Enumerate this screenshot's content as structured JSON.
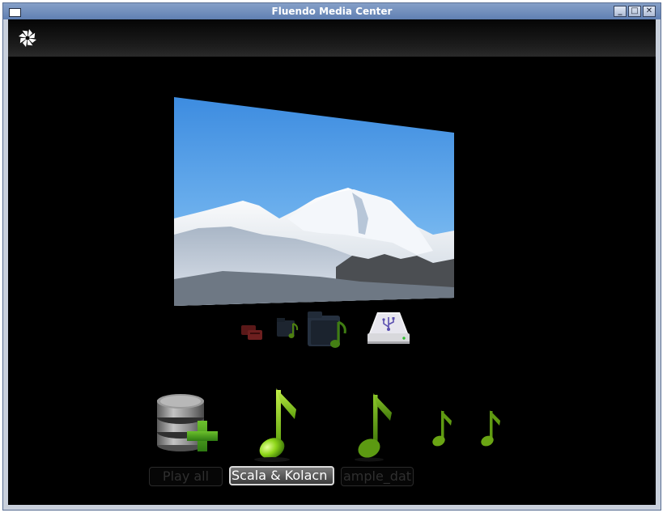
{
  "window": {
    "title": "Fluendo Media Center",
    "buttons": [
      "minimize",
      "maximize",
      "close"
    ]
  },
  "topbar": {
    "logo_icon": "fluendo-pinwheel-icon"
  },
  "preview": {
    "image": "snowy-mountain-photo"
  },
  "devices": [
    {
      "icon": "media-cards-icon",
      "selected": false
    },
    {
      "icon": "music-folder-icon",
      "selected": false
    },
    {
      "icon": "music-folder-icon",
      "selected": false
    },
    {
      "icon": "usb-drive-icon",
      "selected": true
    }
  ],
  "items": [
    {
      "icon": "database-add-icon",
      "label": "Play all",
      "selected": false
    },
    {
      "icon": "music-note-icon",
      "label": "Scala & Kolacn",
      "selected": true
    },
    {
      "icon": "music-note-icon",
      "label": "ample_dat",
      "selected": false
    },
    {
      "icon": "music-note-icon",
      "label": "",
      "selected": false
    },
    {
      "icon": "music-note-icon",
      "label": "",
      "selected": false
    }
  ],
  "colors": {
    "titlebar": "#6f8cbd",
    "background": "#000000",
    "note_green": "#7fcf12",
    "plus_green": "#4ea41c"
  }
}
